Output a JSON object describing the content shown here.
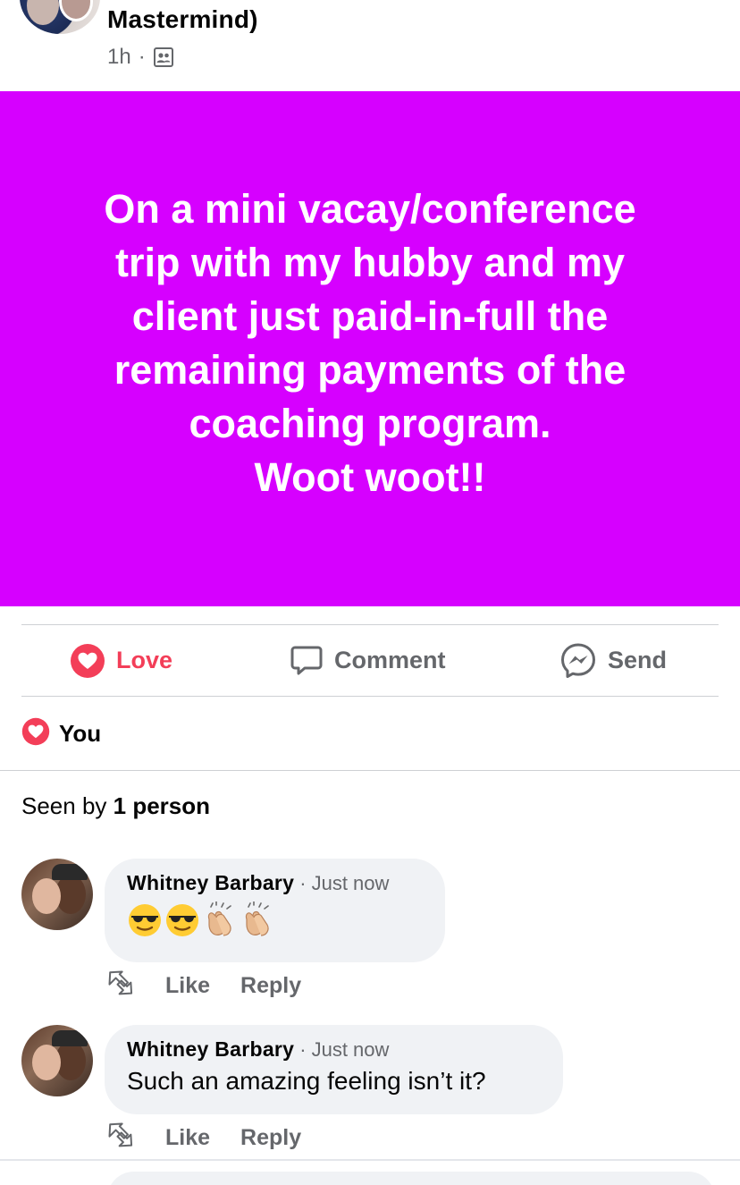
{
  "post": {
    "group_title": "Mastermind)",
    "time": "1h",
    "separator": "·",
    "audience_icon": "group-members-icon",
    "background_color": "#d600ff",
    "text": "On a mini vacay/conference\ntrip with my hubby and my\nclient just paid-in-full the\nremaining payments of the\ncoaching program.\nWoot woot!!"
  },
  "actions": {
    "love_label": "Love",
    "comment_label": "Comment",
    "send_label": "Send",
    "love_color": "#f33e58"
  },
  "reactions": {
    "icon": "love-reaction-icon",
    "names": "You"
  },
  "seen_by": {
    "prefix": "Seen by",
    "count": "1 person"
  },
  "comments": [
    {
      "author": "Whitney Barbary",
      "separator": "·",
      "time": "Just now",
      "emojis": [
        "😎",
        "😎",
        "👏",
        "👏"
      ],
      "like_label": "Like",
      "reply_label": "Reply"
    },
    {
      "author": "Whitney Barbary",
      "separator": "·",
      "time": "Just now",
      "text": "Such an amazing feeling isn’t it?",
      "like_label": "Like",
      "reply_label": "Reply"
    }
  ]
}
